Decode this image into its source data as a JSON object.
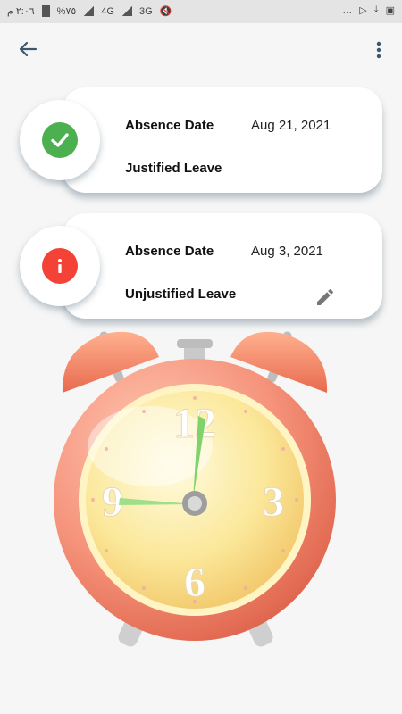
{
  "status_bar": {
    "time": "٢:٠٦ م",
    "battery": "%٧٥",
    "network_4g": "4G",
    "network_3g": "3G"
  },
  "app_bar": {
    "back_icon": "arrow-left-icon",
    "menu_icon": "more-vertical-icon"
  },
  "records": [
    {
      "status": "justified",
      "icon": "check-circle-icon",
      "color": "#4caf50",
      "date_label": "Absence Date",
      "date": "Aug 21, 2021",
      "type": "Justified Leave",
      "editable": false
    },
    {
      "status": "unjustified",
      "icon": "info-circle-icon",
      "color": "#f44336",
      "date_label": "Absence Date",
      "date": "Aug 3, 2021",
      "type": "Unjustified Leave",
      "editable": true,
      "edit_icon": "pencil-icon"
    }
  ],
  "illustration": {
    "name": "alarm-clock",
    "numerals": [
      "12",
      "3",
      "6",
      "9"
    ],
    "colors": {
      "body": "#f5927a",
      "face": "#fbe89a",
      "hands": "#7ed36a"
    }
  }
}
